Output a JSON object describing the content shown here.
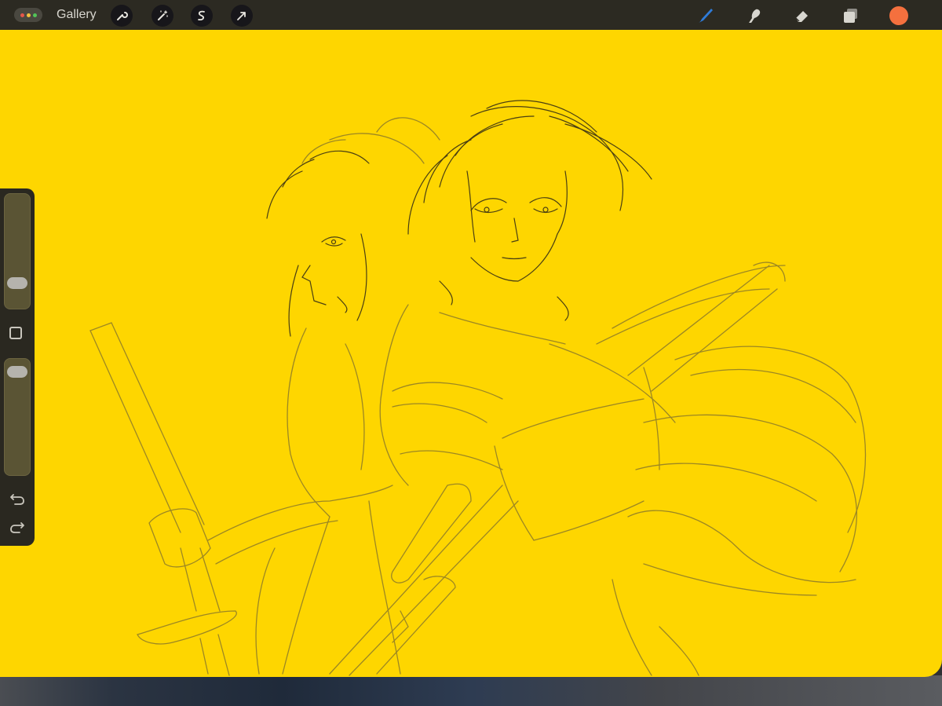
{
  "app": {
    "gallery_label": "Gallery",
    "menu_icon": "ellipsis-menu-icon"
  },
  "toolbar_left": [
    {
      "name": "actions",
      "icon": "wrench-icon"
    },
    {
      "name": "adjustments",
      "icon": "magic-wand-icon"
    },
    {
      "name": "selection",
      "icon": "selection-s-icon"
    },
    {
      "name": "transform",
      "icon": "cursor-arrow-icon"
    }
  ],
  "toolbar_right": [
    {
      "name": "brush",
      "icon": "brush-icon",
      "active": true
    },
    {
      "name": "smudge",
      "icon": "smudge-finger-icon"
    },
    {
      "name": "eraser",
      "icon": "eraser-icon"
    },
    {
      "name": "layers",
      "icon": "layers-icon"
    }
  ],
  "colors": {
    "canvas": "#fed600",
    "topbar": "#2c2a22",
    "active_tool": "#2f7bd8",
    "current_color": "#f4703e",
    "sketch_stroke": "#7a6a24"
  },
  "sidebar": {
    "brush_size_level": 0.18,
    "opacity_level": 0.95,
    "modify_icon": "square-modify-icon",
    "undo_icon": "undo-icon",
    "redo_icon": "redo-icon"
  },
  "canvas": {
    "content": "pencil-sketch-artwork"
  }
}
